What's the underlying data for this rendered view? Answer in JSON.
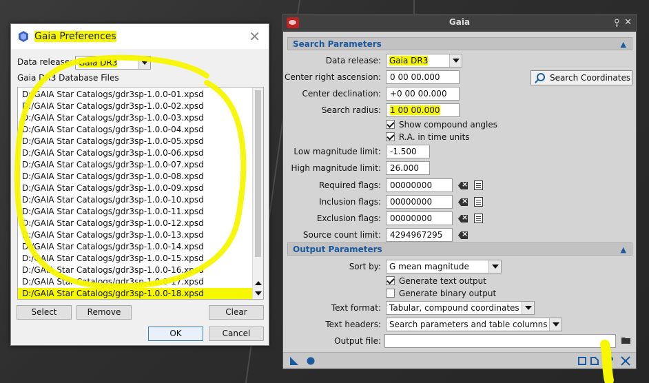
{
  "preferences": {
    "title": "Gaia Preferences",
    "data_release_label": "Data release:",
    "data_release_value": "Gaia DR3",
    "files_label": "Gaia DR3 Database Files",
    "files": [
      "D:/GAIA Star Catalogs/gdr3sp-1.0.0-01.xpsd",
      "D:/GAIA Star Catalogs/gdr3sp-1.0.0-02.xpsd",
      "D:/GAIA Star Catalogs/gdr3sp-1.0.0-03.xpsd",
      "D:/GAIA Star Catalogs/gdr3sp-1.0.0-04.xpsd",
      "D:/GAIA Star Catalogs/gdr3sp-1.0.0-05.xpsd",
      "D:/GAIA Star Catalogs/gdr3sp-1.0.0-06.xpsd",
      "D:/GAIA Star Catalogs/gdr3sp-1.0.0-07.xpsd",
      "D:/GAIA Star Catalogs/gdr3sp-1.0.0-08.xpsd",
      "D:/GAIA Star Catalogs/gdr3sp-1.0.0-09.xpsd",
      "D:/GAIA Star Catalogs/gdr3sp-1.0.0-10.xpsd",
      "D:/GAIA Star Catalogs/gdr3sp-1.0.0-11.xpsd",
      "D:/GAIA Star Catalogs/gdr3sp-1.0.0-12.xpsd",
      "D:/GAIA Star Catalogs/gdr3sp-1.0.0-13.xpsd",
      "D:/GAIA Star Catalogs/gdr3sp-1.0.0-14.xpsd",
      "D:/GAIA Star Catalogs/gdr3sp-1.0.0-15.xpsd",
      "D:/GAIA Star Catalogs/gdr3sp-1.0.0-16.xpsd",
      "D:/GAIA Star Catalogs/gdr3sp-1.0.0-17.xpsd",
      "D:/GAIA Star Catalogs/gdr3sp-1.0.0-18.xpsd"
    ],
    "buttons": {
      "select": "Select",
      "remove": "Remove",
      "clear": "Clear",
      "ok": "OK",
      "cancel": "Cancel"
    }
  },
  "gaia": {
    "title": "Gaia",
    "titlebar_icons": {
      "shade": "⯱",
      "close": "✕"
    },
    "search_section": "Search Parameters",
    "data_release_label": "Data release:",
    "data_release_value": "Gaia DR3",
    "center_ra_label": "Center right ascension:",
    "center_ra_value": "0 00 00.000",
    "center_dec_label": "Center declination:",
    "center_dec_value": "+0 00 00.000",
    "search_radius_label": "Search radius:",
    "search_radius_value": "1 00 00.000",
    "search_coords_button": "Search Coordinates",
    "show_compound_angles": "Show compound angles",
    "ra_time_units": "R.A. in time units",
    "low_mag_label": "Low magnitude limit:",
    "low_mag_value": "-1.500",
    "high_mag_label": "High magnitude limit:",
    "high_mag_value": "26.000",
    "required_flags_label": "Required flags:",
    "required_flags_value": "00000000",
    "inclusion_flags_label": "Inclusion flags:",
    "inclusion_flags_value": "00000000",
    "exclusion_flags_label": "Exclusion flags:",
    "exclusion_flags_value": "00000000",
    "source_count_label": "Source count limit:",
    "source_count_value": "4294967295",
    "output_section": "Output Parameters",
    "sort_by_label": "Sort by:",
    "sort_by_value": "G mean magnitude",
    "generate_text_output": "Generate text output",
    "generate_binary_output": "Generate binary output",
    "text_format_label": "Text format:",
    "text_format_value": "Tabular, compound coordinates",
    "text_headers_label": "Text headers:",
    "text_headers_value": "Search parameters and table columns",
    "output_file_label": "Output file:",
    "output_file_value": "",
    "checkbox_states": {
      "show_compound_angles": true,
      "ra_time_units": true,
      "generate_text_output": true,
      "generate_binary_output": false
    }
  },
  "colors": {
    "highlight": "#f7f700",
    "section_title": "#1a5aa0"
  }
}
